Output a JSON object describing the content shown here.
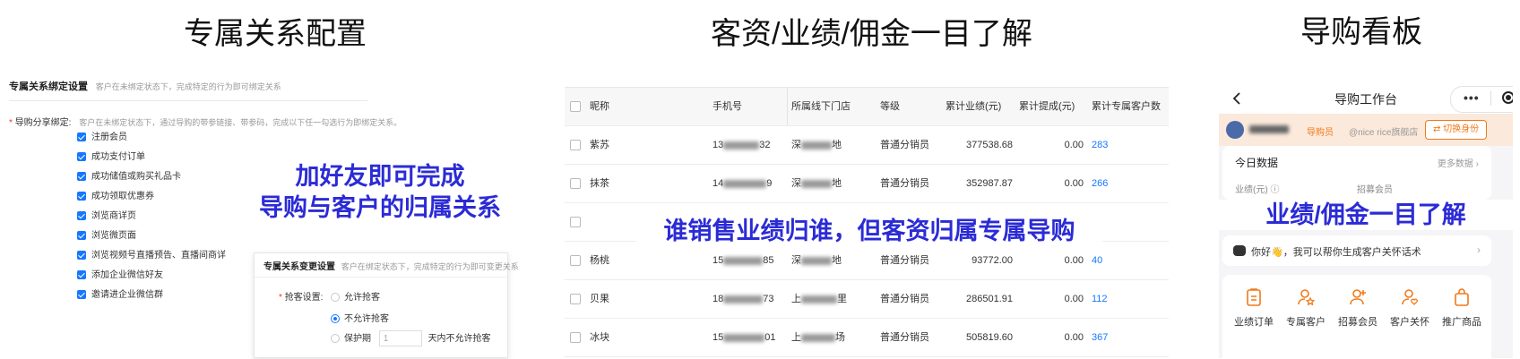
{
  "titles": {
    "left": "专属关系配置",
    "middle": "客资/业绩/佣金一目了解",
    "right": "导购看板"
  },
  "panel1": {
    "header_title": "专属关系绑定设置",
    "header_hint": "客户在未绑定状态下，完成特定的行为即可绑定关系",
    "share_label": "导购分享绑定:",
    "share_hint": "客户在未绑定状态下，通过导购的带参链接、带参码，完成以下任一勾选行为即绑定关系。",
    "options": [
      "注册会员",
      "成功支付订单",
      "成功储值或购买礼品卡",
      "成功领取优惠券",
      "浏览商详页",
      "浏览微页面",
      "浏览视频号直播预告、直播间商详",
      "添加企业微信好友",
      "邀请进企业微信群"
    ],
    "overlay_line1": "加好友即可完成",
    "overlay_line2": "导购与客户的归属关系",
    "card": {
      "title": "专属关系变更设置",
      "hint": "客户在绑定状态下，完成特定的行为即可变更关系",
      "grab_label": "抢客设置:",
      "allow": "允许抢客",
      "deny": "不允许抢客",
      "protect": "保护期",
      "protect_value": "1",
      "protect_suffix": "天内不允许抢客"
    }
  },
  "panel2": {
    "columns": [
      "昵称",
      "手机号",
      "所属线下门店",
      "等级",
      "累计业绩(元)",
      "累计提成(元)",
      "累计专属客户数"
    ],
    "rows": [
      {
        "name": "紫苏",
        "phone_start": "13",
        "phone_end": "32",
        "store_start": "深",
        "store_end": "地",
        "level": "普通分销员",
        "sales": "377538.68",
        "commission": "0.00",
        "customers": "283"
      },
      {
        "name": "抹茶",
        "phone_start": "14",
        "phone_end": "9",
        "store_start": "深",
        "store_end": "地",
        "level": "普通分销员",
        "sales": "352987.87",
        "commission": "0.00",
        "customers": "266"
      },
      {
        "name": "",
        "phone_start": "",
        "phone_end": "",
        "store_start": "",
        "store_end": "",
        "level": "",
        "sales": "",
        "commission": "",
        "customers": ""
      },
      {
        "name": "杨桃",
        "phone_start": "15",
        "phone_end": "85",
        "store_start": "深",
        "store_end": "地",
        "level": "普通分销员",
        "sales": "93772.00",
        "commission": "0.00",
        "customers": "40"
      },
      {
        "name": "贝果",
        "phone_start": "18",
        "phone_end": "73",
        "store_start": "上",
        "store_end": "里",
        "level": "普通分销员",
        "sales": "286501.91",
        "commission": "0.00",
        "customers": "112"
      },
      {
        "name": "冰块",
        "phone_start": "15",
        "phone_end": "01",
        "store_start": "上",
        "store_end": "场",
        "level": "普通分销员",
        "sales": "505819.60",
        "commission": "0.00",
        "customers": "367"
      }
    ],
    "overlay": "谁销售业绩归谁，但客资归属专属导购"
  },
  "panel3": {
    "nav_title": "导购工作台",
    "role_badge": "导购员",
    "shop_name": "@nice rice旗舰店",
    "switch_label": "切换身份",
    "today_title": "今日数据",
    "more_label": "更多数据",
    "metric1": "业绩(元)",
    "metric2": "招募会员",
    "overlay": "业绩/佣金一目了解",
    "assistant_text": "你好👋，我可以帮你生成客户关怀话术",
    "quick_actions": [
      "业绩订单",
      "专属客户",
      "招募会员",
      "客户关怀",
      "推广商品"
    ]
  },
  "colors": {
    "accent": "#2b2bd6",
    "primary": "#1677ff",
    "orange": "#f07a1a"
  }
}
